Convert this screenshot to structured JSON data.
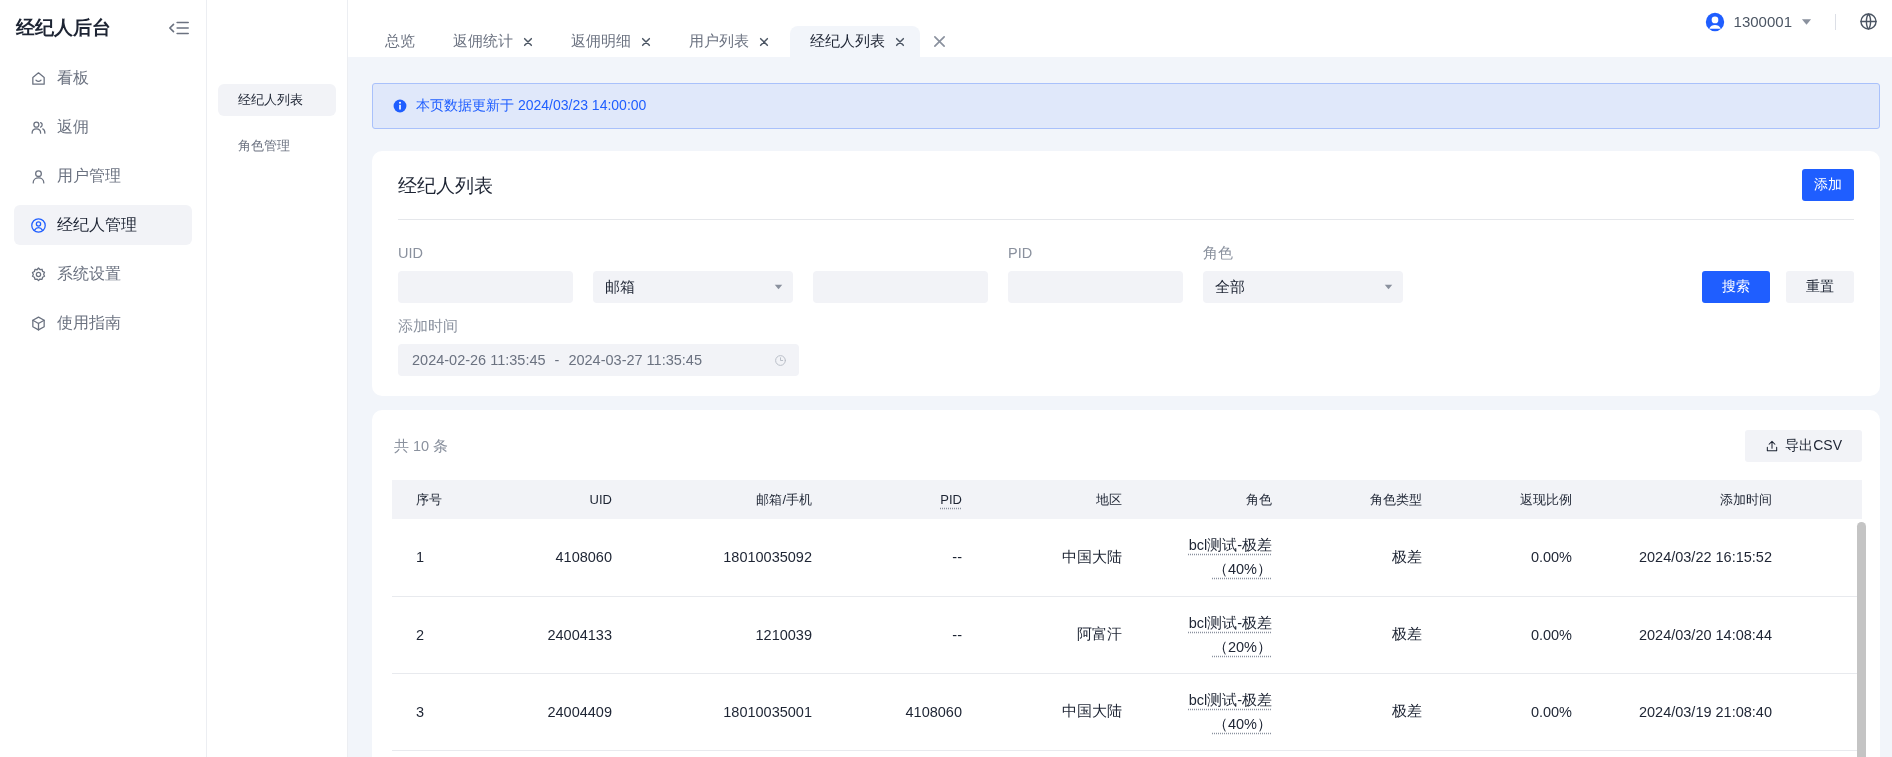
{
  "sidebar": {
    "title": "经纪人后台",
    "items": [
      {
        "label": "看板",
        "selected": false
      },
      {
        "label": "返佣",
        "selected": false
      },
      {
        "label": "用户管理",
        "selected": false
      },
      {
        "label": "经纪人管理",
        "selected": true
      },
      {
        "label": "系统设置",
        "selected": false
      },
      {
        "label": "使用指南",
        "selected": false
      }
    ]
  },
  "submenu": {
    "items": [
      {
        "label": "经纪人列表",
        "selected": true
      },
      {
        "label": "角色管理",
        "selected": false
      }
    ]
  },
  "tabs": [
    {
      "label": "总览",
      "closable": false,
      "selected": false
    },
    {
      "label": "返佣统计",
      "closable": true,
      "selected": false
    },
    {
      "label": "返佣明细",
      "closable": true,
      "selected": false
    },
    {
      "label": "用户列表",
      "closable": true,
      "selected": false
    },
    {
      "label": "经纪人列表",
      "closable": true,
      "selected": true
    }
  ],
  "user": {
    "name": "1300001"
  },
  "alert": {
    "text": "本页数据更新于 2024/03/23 14:00:00"
  },
  "filter_card": {
    "title": "经纪人列表",
    "add_button": "添加",
    "fields": [
      {
        "kind": "input",
        "label": "UID"
      },
      {
        "kind": "select",
        "value": "邮箱"
      },
      {
        "kind": "input"
      },
      {
        "kind": "input",
        "label": "PID"
      },
      {
        "kind": "select",
        "label": "角色",
        "value": "全部"
      }
    ],
    "date_range": {
      "label": "添加时间",
      "start": "2024-02-26 11:35:45",
      "separator": "-",
      "end": "2024-03-27 11:35:45"
    },
    "search_button": "搜索",
    "reset_button": "重置"
  },
  "table_card": {
    "total": "共 10 条",
    "export_button": "导出CSV",
    "columns": [
      "序号",
      "UID",
      "邮箱/手机",
      "PID",
      "地区",
      "角色",
      "角色类型",
      "返现比例",
      "添加时间"
    ],
    "rows": [
      [
        "1",
        "4108060",
        "18010035092",
        "--",
        "中国大陆",
        "bcl测试-极差（40%）",
        "极差",
        "0.00%",
        "2024/03/22 16:15:52"
      ],
      [
        "2",
        "24004133",
        "1210039",
        "--",
        "阿富汗",
        "bcl测试-极差（20%）",
        "极差",
        "0.00%",
        "2024/03/20 14:08:44"
      ],
      [
        "3",
        "24004409",
        "18010035001",
        "4108060",
        "中国大陆",
        "bcl测试-极差（40%）",
        "极差",
        "0.00%",
        "2024/03/19 21:08:40"
      ]
    ]
  }
}
